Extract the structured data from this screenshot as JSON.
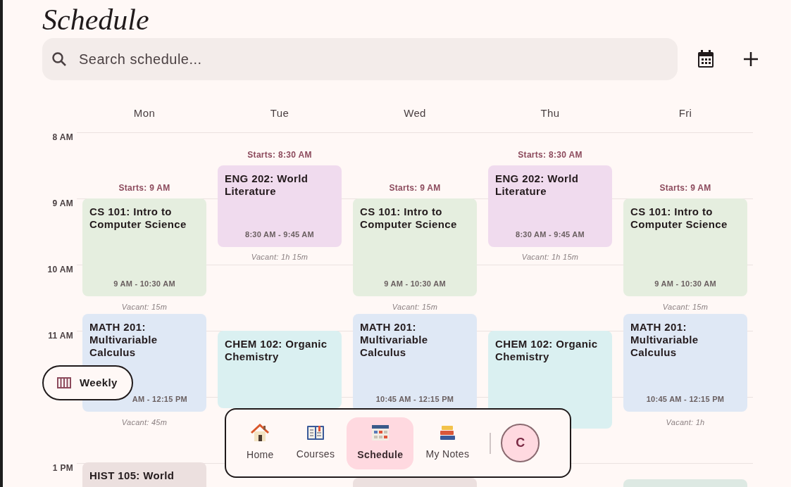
{
  "title": "Schedule",
  "search": {
    "placeholder": "Search schedule..."
  },
  "days": [
    {
      "name": "Mon",
      "items": [
        {
          "kind": "start",
          "text": "Starts: 9 AM"
        },
        {
          "kind": "class",
          "title": "CS 101: Intro to Computer Science",
          "time": "9 AM - 10:30 AM",
          "color": "#e5eedf"
        },
        {
          "kind": "vacant",
          "text": "Vacant: 15m"
        },
        {
          "kind": "class",
          "title": "MATH 201: Multivariable Calculus",
          "time": "AM - 12:15 PM",
          "color": "#dfe8f5"
        },
        {
          "kind": "vacant",
          "text": "Vacant: 45m"
        },
        {
          "kind": "class",
          "title": "HIST 105: World",
          "color": "#ece0df"
        }
      ]
    },
    {
      "name": "Tue",
      "items": [
        {
          "kind": "start",
          "text": "Starts: 8:30 AM"
        },
        {
          "kind": "class",
          "title": "ENG 202: World Literature",
          "time": "8:30 AM - 9:45 AM",
          "color": "#f0dbee"
        },
        {
          "kind": "vacant",
          "text": "Vacant: 1h 15m"
        },
        {
          "kind": "class",
          "title": "CHEM 102: Organic Chemistry",
          "color": "#daf0f1"
        }
      ]
    },
    {
      "name": "Wed",
      "items": [
        {
          "kind": "start",
          "text": "Starts: 9 AM"
        },
        {
          "kind": "class",
          "title": "CS 101: Intro to Computer Science",
          "time": "9 AM - 10:30 AM",
          "color": "#e5eedf"
        },
        {
          "kind": "vacant",
          "text": "Vacant: 15m"
        },
        {
          "kind": "class",
          "title": "MATH 201: Multivariable Calculus",
          "time": "10:45 AM - 12:15 PM",
          "color": "#dfe8f5"
        },
        {
          "kind": "class",
          "color": "#ece0df"
        }
      ]
    },
    {
      "name": "Thu",
      "items": [
        {
          "kind": "start",
          "text": "Starts: 8:30 AM"
        },
        {
          "kind": "class",
          "title": "ENG 202: World Literature",
          "time": "8:30 AM - 9:45 AM",
          "color": "#f0dbee"
        },
        {
          "kind": "vacant",
          "text": "Vacant: 1h 15m"
        },
        {
          "kind": "class",
          "title": "CHEM 102: Organic Chemistry",
          "color": "#daf0f1"
        }
      ]
    },
    {
      "name": "Fri",
      "items": [
        {
          "kind": "start",
          "text": "Starts: 9 AM"
        },
        {
          "kind": "class",
          "title": "CS 101: Intro to Computer Science",
          "time": "9 AM - 10:30 AM",
          "color": "#e5eedf"
        },
        {
          "kind": "vacant",
          "text": "Vacant: 15m"
        },
        {
          "kind": "class",
          "title": "MATH 201: Multivariable Calculus",
          "time": "10:45 AM - 12:15 PM",
          "color": "#dfe8f5"
        },
        {
          "kind": "vacant",
          "text": "Vacant: 1h"
        },
        {
          "kind": "class",
          "color": "#dde9e3"
        }
      ]
    }
  ],
  "hours": [
    "8 AM",
    "9 AM",
    "10 AM",
    "11 AM",
    "1 PM"
  ],
  "view_button": {
    "label": "Weekly"
  },
  "nav": [
    {
      "label": "Home",
      "selected": false
    },
    {
      "label": "Courses",
      "selected": false
    },
    {
      "label": "Schedule",
      "selected": true
    },
    {
      "label": "My Notes",
      "selected": false
    }
  ],
  "avatar": {
    "initial": "C"
  }
}
